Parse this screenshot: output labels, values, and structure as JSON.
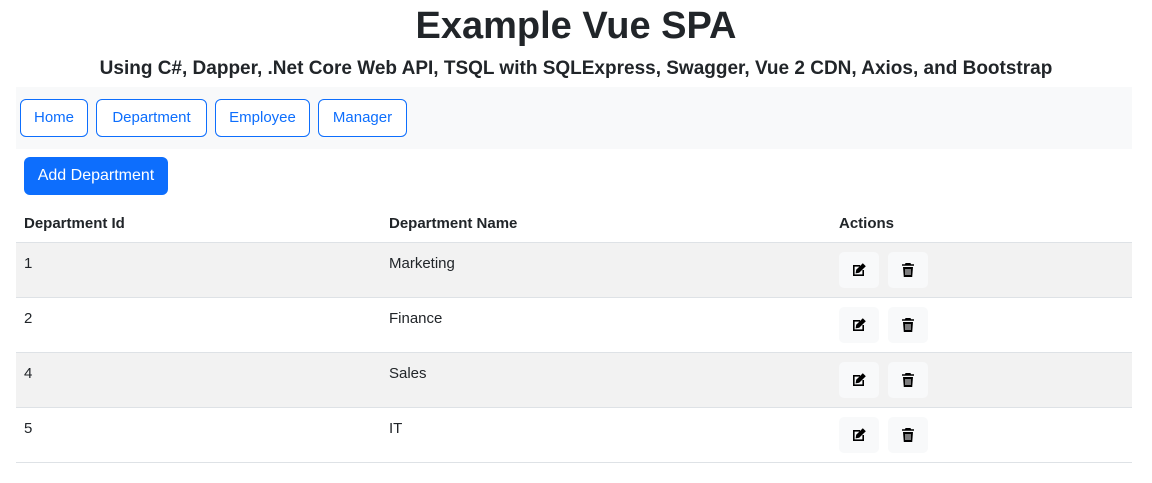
{
  "header": {
    "title": "Example Vue SPA",
    "subtitle": "Using C#, Dapper, .Net Core Web API, TSQL with SQLExpress, Swagger, Vue 2 CDN, Axios, and Bootstrap"
  },
  "nav": {
    "items": [
      {
        "label": "Home"
      },
      {
        "label": "Department"
      },
      {
        "label": "Employee"
      },
      {
        "label": "Manager"
      }
    ]
  },
  "toolbar": {
    "add_label": "Add Department"
  },
  "table": {
    "headers": [
      "Department Id",
      "Department Name",
      "Actions"
    ],
    "rows": [
      {
        "id": "1",
        "name": "Marketing",
        "actions": [
          "edit-icon",
          "trash-icon"
        ]
      },
      {
        "id": "2",
        "name": "Finance",
        "actions": [
          "edit-icon",
          "trash-icon"
        ]
      },
      {
        "id": "4",
        "name": "Sales",
        "actions": [
          "edit-icon",
          "trash-icon"
        ]
      },
      {
        "id": "5",
        "name": "IT",
        "actions": [
          "edit-icon",
          "trash-icon"
        ]
      }
    ]
  },
  "colors": {
    "primary": "#0d6efd",
    "navbar_bg": "#f8f9fa",
    "stripe_bg": "#f2f2f2",
    "text": "#212529"
  }
}
